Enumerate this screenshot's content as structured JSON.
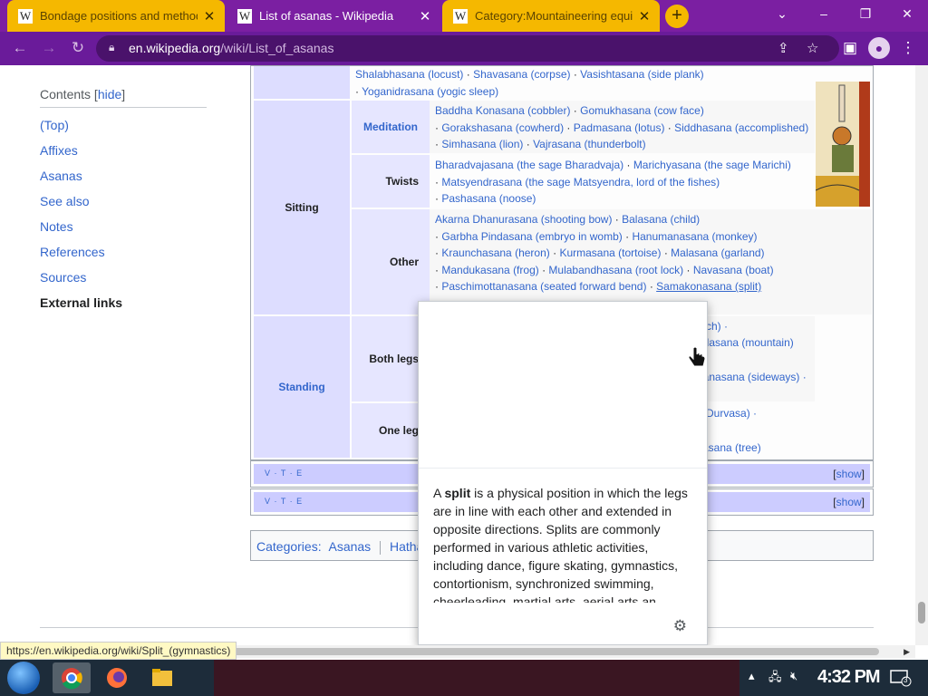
{
  "browser": {
    "tabs": [
      {
        "title": "Bondage positions and methods",
        "favicon": "W",
        "state": "inactive"
      },
      {
        "title": "List of asanas - Wikipedia",
        "favicon": "W",
        "state": "active"
      },
      {
        "title": "Category:Mountaineering equip",
        "favicon": "W",
        "state": "inactive"
      }
    ],
    "new_tab": "+",
    "window_controls": {
      "chevron": "⌄",
      "minimize": "–",
      "restore": "❐",
      "close": "✕"
    },
    "url_domain": "en.wikipedia.org",
    "url_path": "/wiki/List_of_asanas",
    "icons": {
      "back": "arrow-left-icon",
      "forward": "arrow-right-icon",
      "reload": "reload-icon",
      "lock": "lock-icon",
      "share": "share-icon",
      "star": "star-icon",
      "sidepanel": "side-panel-icon",
      "profile": "profile-icon",
      "menu": "kebab-menu-icon"
    }
  },
  "toc": {
    "title": "Contents",
    "hide_label": "hide",
    "items": [
      "(Top)",
      "Affixes",
      "Asanas",
      "See also",
      "Notes",
      "References",
      "Sources",
      "External links"
    ],
    "active_index": 7
  },
  "navbox": {
    "top_list": [
      [
        "Shalabhasana (locust)",
        "Shavasana (corpse)",
        "Vasishtasana (side plank)"
      ],
      [
        "Yoganidrasana (yogic sleep)"
      ]
    ],
    "groups": {
      "sitting": "Sitting",
      "standing": "Standing"
    },
    "subgroups": {
      "meditation": "Meditation",
      "twists": "Twists",
      "other": "Other",
      "both_legs": "Both legs",
      "one_leg": "One leg"
    },
    "meditation": [
      [
        "Baddha Konasana (cobbler)",
        "Gomukhasana (cow face)"
      ],
      [
        "Gorakshasana (cowherd)",
        "Padmasana (lotus)",
        "Siddhasana (accomplished)"
      ],
      [
        "Simhasana (lion)",
        "Vajrasana (thunderbolt)"
      ]
    ],
    "twists": [
      [
        "Bharadvajasana (the sage Bharadvaja)",
        "Marichyasana (the sage Marichi)"
      ],
      [
        "Matsyendrasana (the sage Matsyendra, lord of the fishes)"
      ],
      [
        "Pashasana (noose)"
      ]
    ],
    "other": [
      [
        "Akarna Dhanurasana (shooting bow)",
        "Balasana (child)"
      ],
      [
        "Garbha Pindasana (embryo in womb)",
        "Hanumanasana (monkey)"
      ],
      [
        "Kraunchasana (heron)",
        "Kurmasana (tortoise)",
        "Malasana (garland)"
      ],
      [
        "Mandukasana (frog)",
        "Mulabandhasana (root lock)",
        "Navasana (boat)"
      ],
      [
        "Paschimottanasana (seated forward bend)",
        "Samakonasana (split)"
      ]
    ],
    "both_legs_fragments": [
      "etch) ·",
      "adasana (mountain)",
      "hanasana (sideways) ·"
    ],
    "one_leg_fragments": [
      "e Durvasa) ·",
      "asana (tree)"
    ],
    "vte": "V · T · E",
    "show_label": "show"
  },
  "categories": {
    "label": "Categories",
    "items": [
      "Asanas",
      "Hatha"
    ]
  },
  "popup": {
    "extract_bold": "split",
    "extract_pre": "A ",
    "extract_post": " is a physical position in which the legs are in line with each other and extended in opposite directions. Splits are commonly performed in various athletic activities, including dance, figure skating, gymnastics, contortionism, synchronized swimming, cheerleading, martial arts, aerial arts an",
    "settings_icon": "gear-icon"
  },
  "status_url": "https://en.wikipedia.org/wiki/Split_(gymnastics)",
  "taskbar": {
    "clock": "4:32 PM",
    "notification_count": "3",
    "apps": [
      "chrome-icon",
      "firefox-icon",
      "file-explorer-icon"
    ]
  },
  "colors": {
    "chrome_frame": "#7b1fa2",
    "tab_inactive": "#f5b800",
    "link": "#3366cc",
    "navbox_group": "#ddddff"
  }
}
